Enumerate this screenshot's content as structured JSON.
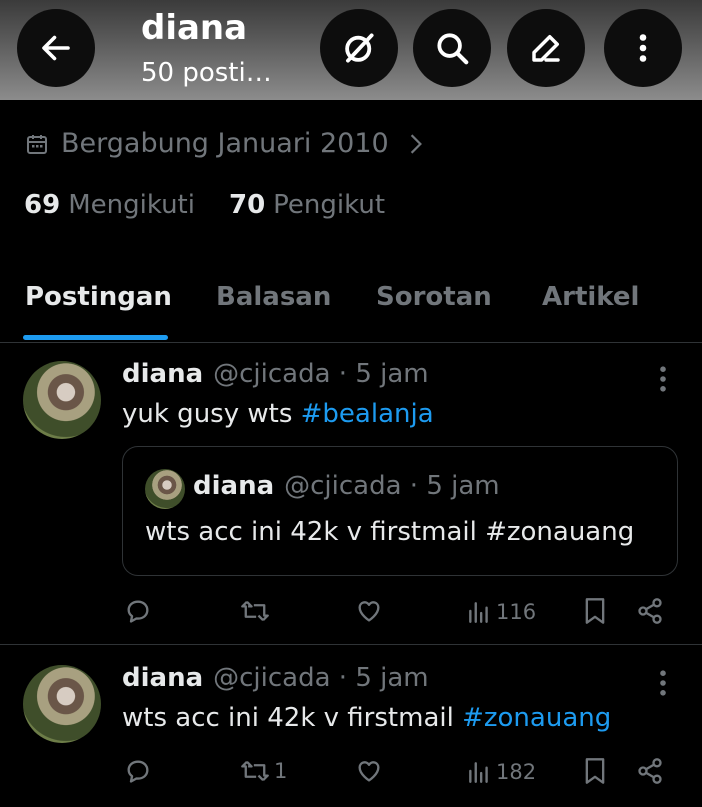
{
  "header": {
    "title": "diana",
    "subtitle": "50 posti…",
    "buttons": [
      "back-arrow-icon",
      "grok-icon",
      "search-icon",
      "edit-icon",
      "more-vertical-icon"
    ]
  },
  "profile": {
    "joined": "Bergabung Januari 2010",
    "following_count": "69",
    "following_label": "Mengikuti",
    "followers_count": "70",
    "followers_label": "Pengikut"
  },
  "tabs": [
    {
      "label": "Postingan",
      "active": true
    },
    {
      "label": "Balasan",
      "active": false
    },
    {
      "label": "Sorotan",
      "active": false
    },
    {
      "label": "Artikel",
      "active": false
    }
  ],
  "posts": [
    {
      "name": "diana",
      "handle": "@cjicada · 5 jam",
      "text": "yuk gusy wts ",
      "hashtag": "#bealanja",
      "quote": {
        "name": "diana",
        "handle": "@cjicada · 5 jam",
        "text": "wts acc ini 42k v firstmail #zonauang"
      },
      "retweets": "",
      "views": "116"
    },
    {
      "name": "diana",
      "handle": "@cjicada · 5 jam",
      "text": "wts acc ini 42k v firstmail ",
      "hashtag": "#zonauang",
      "retweets": "1",
      "views": "182"
    }
  ],
  "colors": {
    "background": "#000000",
    "accent": "#1d9bf0",
    "muted": "#71767b",
    "text": "#e7e9ea"
  }
}
